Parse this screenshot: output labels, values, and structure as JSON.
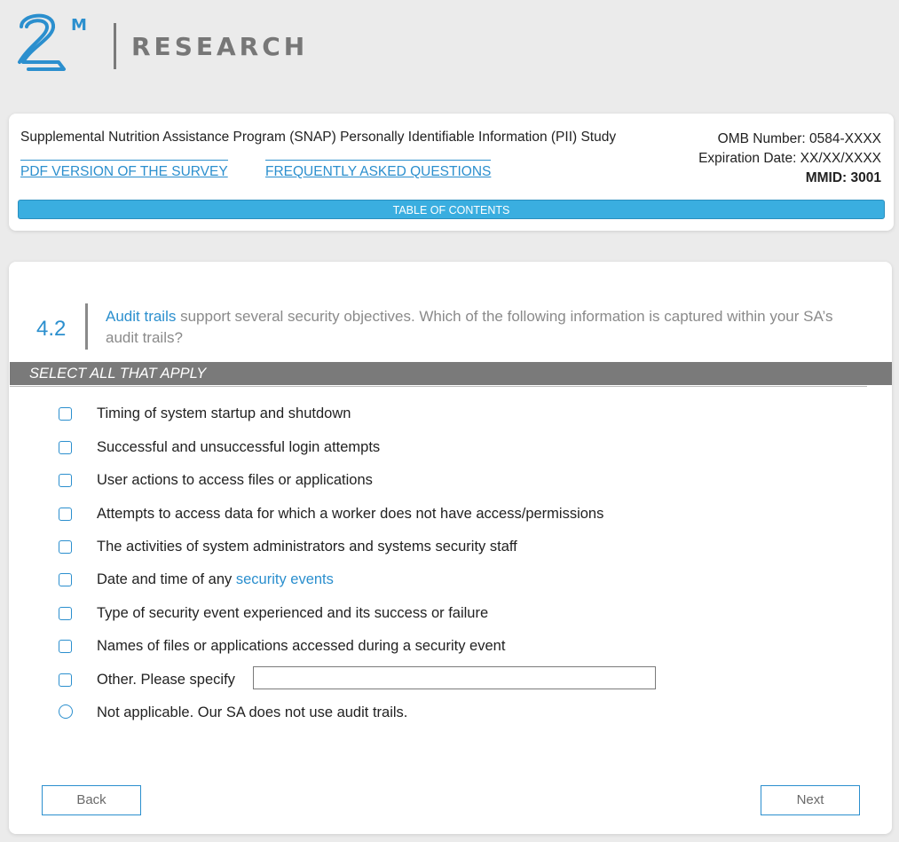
{
  "brand": {
    "logo_mark": "2M",
    "name": "RESEARCH",
    "colors": {
      "accent": "#2b8fce",
      "toc_bar": "#3aaee0",
      "select_bar": "#7a7a7a"
    }
  },
  "header": {
    "study_title": "Supplemental Nutrition Assistance Program (SNAP) Personally Identifiable Information (PII) Study",
    "omb_number": "OMB Number: 0584-XXXX",
    "expiration": "Expiration Date: XX/XX/XXXX",
    "mmid": "MMID: 3001",
    "links": {
      "pdf": "PDF VERSION OF THE SURVEY",
      "faq": "FREQUENTLY ASKED QUESTIONS"
    },
    "toc_label": "TABLE OF CONTENTS"
  },
  "question": {
    "number": "4.2",
    "keyword": "Audit trails",
    "text_rest": " support several security objectives. Which of the following information is captured within your SA’s audit trails?",
    "instruction": "SELECT ALL THAT APPLY",
    "options": [
      {
        "label": "Timing of system startup and shutdown",
        "type": "checkbox"
      },
      {
        "label": "Successful and unsuccessful login attempts",
        "type": "checkbox"
      },
      {
        "label": "User actions to access files or applications",
        "type": "checkbox"
      },
      {
        "label": "Attempts to access data for which a worker does not have access/permissions",
        "type": "checkbox"
      },
      {
        "label": "The activities of system administrators and systems security staff",
        "type": "checkbox"
      },
      {
        "label_prefix": "Date and time of any ",
        "label_keyword": "security events",
        "type": "checkbox"
      },
      {
        "label": "Type of security event experienced and its success or failure",
        "type": "checkbox"
      },
      {
        "label": "Names of files or applications accessed during a security event",
        "type": "checkbox"
      },
      {
        "label": "Other. Please specify",
        "type": "checkbox",
        "other_value": ""
      },
      {
        "label": "Not applicable. Our SA does not use audit trails.",
        "type": "radio"
      }
    ]
  },
  "nav": {
    "back": "Back",
    "next": "Next"
  }
}
